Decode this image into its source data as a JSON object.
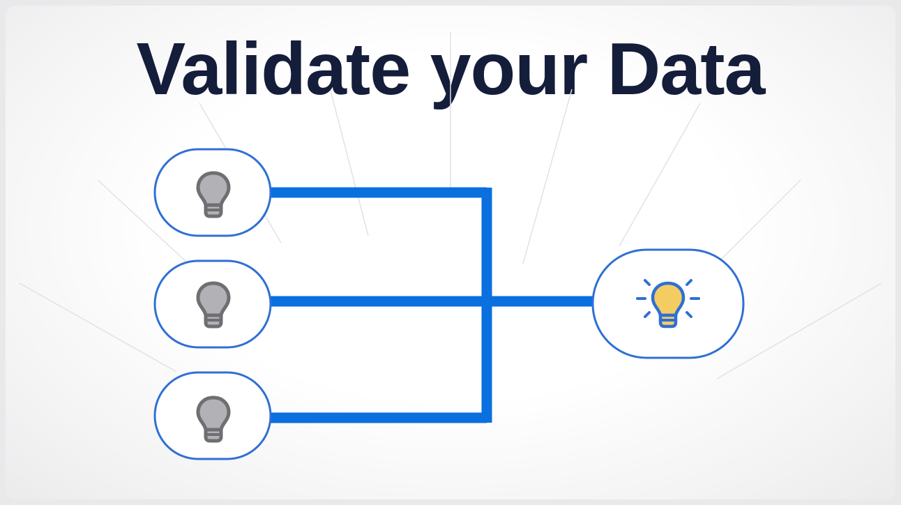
{
  "title": "Validate your Data",
  "colors": {
    "background": "#ffffff",
    "title": "#141d3a",
    "connector": "#0a6fdf",
    "node_border": "#2f6fd4",
    "bulb_off_fill": "#b1b1b6",
    "bulb_off_stroke": "#6f6f71",
    "bulb_on_fill": "#f4cd62",
    "bulb_on_stroke": "#2f6fd4"
  },
  "nodes": {
    "inputs": [
      {
        "name": "input-node-1",
        "icon": "lightbulb-off-icon"
      },
      {
        "name": "input-node-2",
        "icon": "lightbulb-off-icon"
      },
      {
        "name": "input-node-3",
        "icon": "lightbulb-off-icon"
      }
    ],
    "output": {
      "name": "output-node",
      "icon": "lightbulb-on-icon"
    }
  }
}
